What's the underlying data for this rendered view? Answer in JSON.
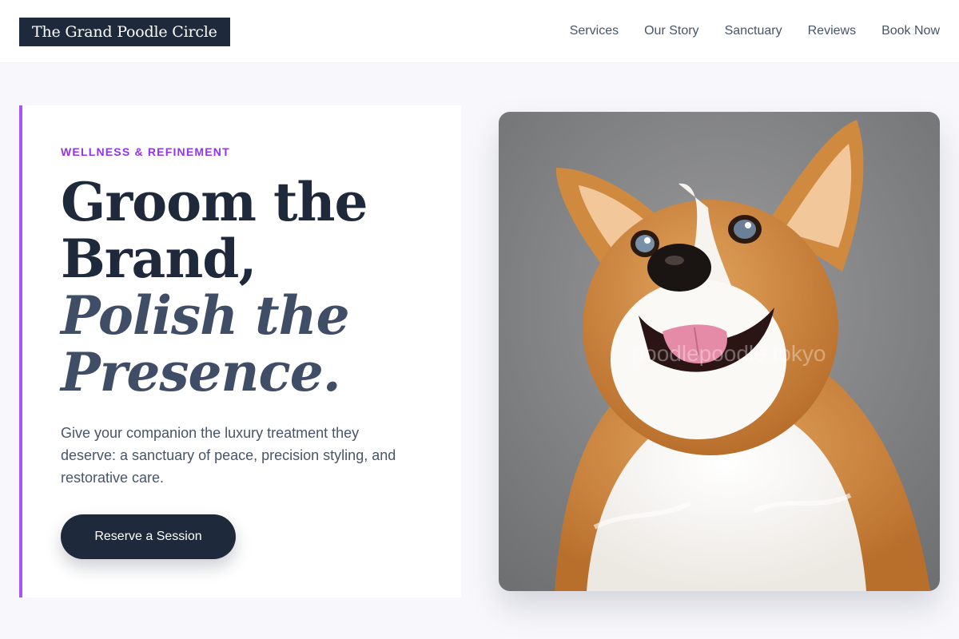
{
  "header": {
    "logo": "The Grand Poodle Circle",
    "nav": [
      "Services",
      "Our Story",
      "Sanctuary",
      "Reviews",
      "Book Now"
    ]
  },
  "hero": {
    "eyebrow": "WELLNESS & REFINEMENT",
    "headline_line1": "Groom the",
    "headline_line2": "Brand,",
    "headline_line3": "Polish the",
    "headline_line4": "Presence.",
    "description": "Give your companion the luxury treatment they deserve: a sanctuary of peace, precision styling, and restorative care.",
    "cta_label": "Reserve a Session",
    "image_watermark": "poodlepoodle.tokyo"
  },
  "colors": {
    "accent": "#a855f7",
    "eyebrow": "#9333ea",
    "navy": "#1e293b",
    "background": "#f8f8fc"
  }
}
